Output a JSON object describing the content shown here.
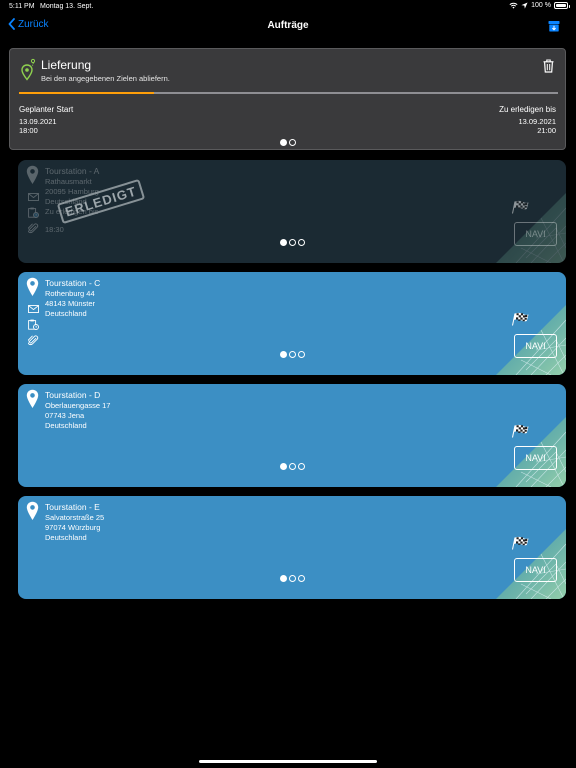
{
  "status_bar": {
    "time": "5:11 PM",
    "date": "Montag 13. Sept.",
    "battery": "100 %"
  },
  "nav": {
    "back_label": "Zurück",
    "title": "Aufträge"
  },
  "order": {
    "title": "Lieferung",
    "subtitle": "Bei den angegebenen Zielen abliefern.",
    "progress": 0.25,
    "planned_start_label": "Geplanter Start",
    "planned_start_date": "13.09.2021",
    "planned_start_time": "18:00",
    "due_label": "Zu erledigen bis",
    "due_date": "13.09.2021",
    "due_time": "21:00",
    "page_count": 2,
    "page_active": 0
  },
  "stations": [
    {
      "title": "Tourstation - A",
      "street": "Rathausmarkt",
      "city": "20095 Hamburg",
      "country": "Deutschland",
      "due_label": "Zu erledigen bis",
      "due_time": "18:30",
      "status": "ERLEDIGT",
      "done": true,
      "navi_label": "NAVI",
      "page_count": 3,
      "page_active": 0
    },
    {
      "title": "Tourstation - C",
      "street": "Rothenburg 44",
      "city": "48143 Münster",
      "country": "Deutschland",
      "done": false,
      "navi_label": "NAVI",
      "page_count": 3,
      "page_active": 0
    },
    {
      "title": "Tourstation - D",
      "street": "Oberlauengasse 17",
      "city": "07743 Jena",
      "country": "Deutschland",
      "done": false,
      "navi_label": "NAVI",
      "page_count": 3,
      "page_active": 0
    },
    {
      "title": "Tourstation - E",
      "street": "Salvatorstraße 25",
      "city": "97074 Würzburg",
      "country": "Deutschland",
      "done": false,
      "navi_label": "NAVI",
      "page_count": 3,
      "page_active": 0
    }
  ],
  "colors": {
    "accent": "#0a84ff",
    "progress": "#ff9f0a",
    "station_open": "#3c8fc4",
    "station_done": "#1b2a33",
    "order_card": "#3a3a3c"
  }
}
